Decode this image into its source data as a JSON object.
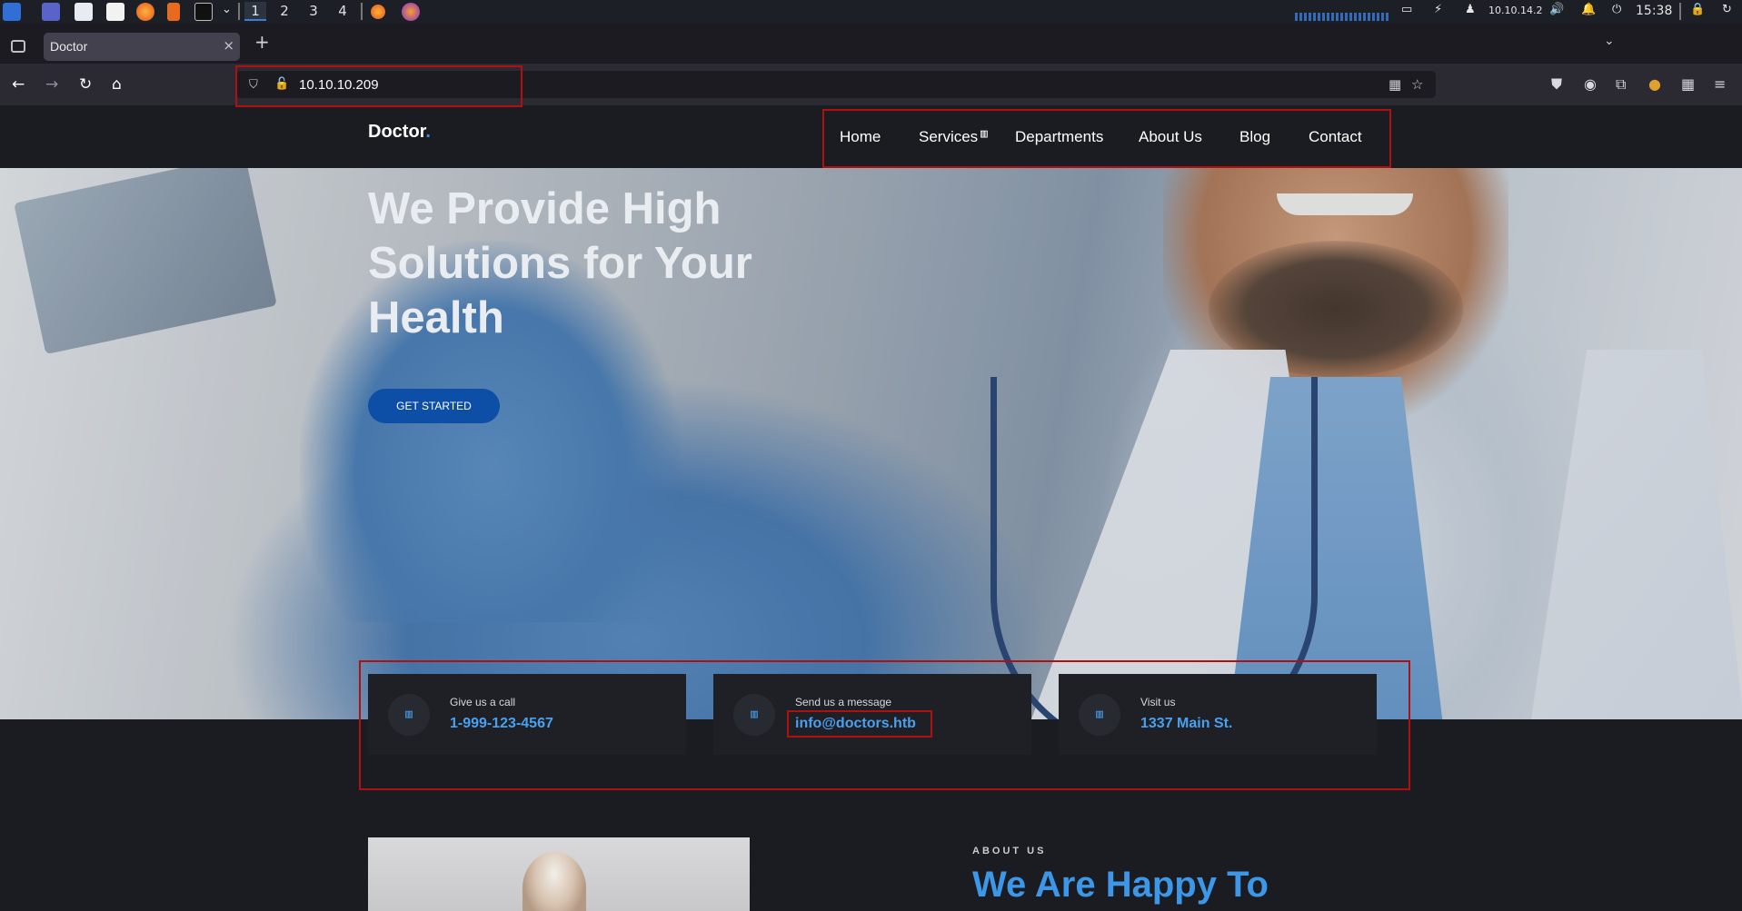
{
  "taskbar": {
    "workspaces": [
      "1",
      "2",
      "3",
      "4"
    ],
    "ip": "10.10.14.2",
    "clock": "15:38",
    "icons": [
      "kali-menu-icon",
      "desktop-icon",
      "files-icon",
      "text-editor-icon",
      "firefox-icon",
      "burp-icon",
      "terminal-icon",
      "firefox-icon",
      "firefox-dev-icon"
    ]
  },
  "browser": {
    "tab_title": "Doctor",
    "tab_close": "×",
    "new_tab": "+",
    "url": "10.10.10.209"
  },
  "site": {
    "logo": "Doctor",
    "logo_dot": ".",
    "menu": [
      "Home",
      "Services",
      "Departments",
      "About Us",
      "Blog",
      "Contact"
    ],
    "hero_title": "We Provide High Solutions for Your Health",
    "cta": "GET STARTED",
    "contacts": [
      {
        "label": "Give us a call",
        "value": "1-999-123-4567",
        "icon": "phone-icon"
      },
      {
        "label": "Send us a message",
        "value": "info@doctors.htb",
        "icon": "mail-icon"
      },
      {
        "label": "Visit us",
        "value": "1337 Main St.",
        "icon": "location-icon"
      }
    ],
    "about_kicker": "ABOUT US",
    "about_heading": "We Are Happy To"
  },
  "colors": {
    "accent": "#3d97e8",
    "cta": "#0d4ea6",
    "annotation": "#b01010",
    "page_bg": "#1b1c21"
  }
}
